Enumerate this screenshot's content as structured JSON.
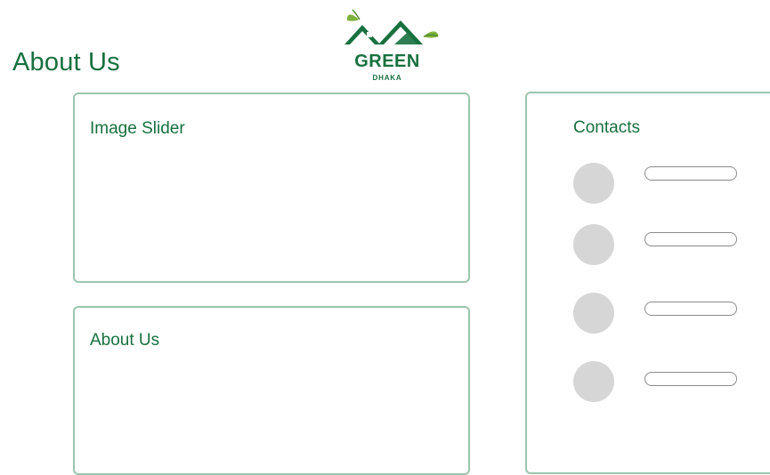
{
  "page": {
    "title": "About Us"
  },
  "logo": {
    "name": "GREEN",
    "subtitle": "DHAKA"
  },
  "image_slider": {
    "title": "Image Slider"
  },
  "about_section": {
    "title": "About Us"
  },
  "contacts": {
    "title": "Contacts",
    "items": [
      {
        "avatar_icon": "avatar-placeholder",
        "field_value": ""
      },
      {
        "avatar_icon": "avatar-placeholder",
        "field_value": ""
      },
      {
        "avatar_icon": "avatar-placeholder",
        "field_value": ""
      },
      {
        "avatar_icon": "avatar-placeholder",
        "field_value": ""
      }
    ]
  },
  "colors": {
    "brand_green": "#17703f",
    "card_border": "#9cc5ae",
    "avatar_gray": "#d6d6d6",
    "field_border": "#8b8b8b",
    "leaf_green": "#7db23c"
  },
  "icons": {
    "logo": "house-roof-leaves-logo"
  }
}
